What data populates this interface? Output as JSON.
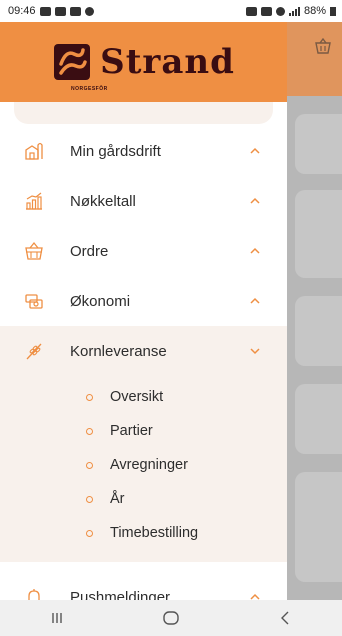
{
  "status_bar": {
    "time": "09:46",
    "battery": "88%"
  },
  "brand": {
    "name": "Strand",
    "tagline": "NORGESFÔR",
    "color_primary": "#ef8f43",
    "color_text": "#3a0d12"
  },
  "menu": {
    "items": [
      {
        "label": "Min gårdsdrift",
        "icon": "farm-icon",
        "expanded": false
      },
      {
        "label": "Nøkkeltall",
        "icon": "chart-icon",
        "expanded": false
      },
      {
        "label": "Ordre",
        "icon": "basket-icon",
        "expanded": false
      },
      {
        "label": "Økonomi",
        "icon": "money-icon",
        "expanded": false
      },
      {
        "label": "Kornleveranse",
        "icon": "grain-icon",
        "expanded": true
      },
      {
        "label": "Pushmeldinger",
        "icon": "bell-icon",
        "expanded": false
      }
    ],
    "kornleveranse_sub": [
      {
        "label": "Oversikt"
      },
      {
        "label": "Partier"
      },
      {
        "label": "Avregninger"
      },
      {
        "label": "År"
      },
      {
        "label": "Timebestilling"
      }
    ]
  },
  "nav": {
    "recent": "recent-apps-icon",
    "home": "home-icon",
    "back": "back-icon"
  }
}
